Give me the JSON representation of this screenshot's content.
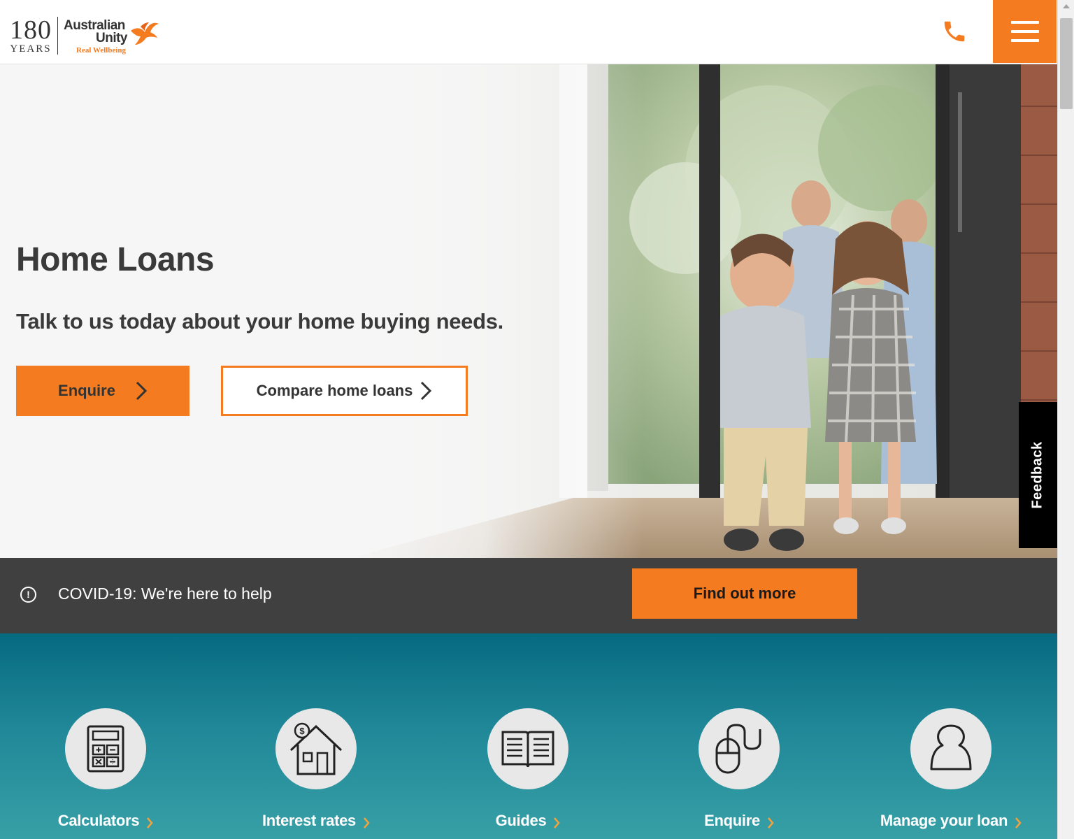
{
  "header": {
    "logo": {
      "anniversary_number": "180",
      "anniversary_word": "YEARS",
      "brand_line1": "Australian",
      "brand_line2": "Unity",
      "tagline": "Real Wellbeing"
    },
    "phone_icon": "phone-icon",
    "menu_icon": "hamburger-menu-icon"
  },
  "hero": {
    "title": "Home Loans",
    "subtitle": "Talk to us today about your home buying needs.",
    "enquire_label": "Enquire",
    "compare_label": "Compare home loans"
  },
  "feedback": {
    "label": "Feedback"
  },
  "covid": {
    "text": "COVID-19: We're here to help",
    "button_label": "Find out more"
  },
  "tiles": [
    {
      "label": "Calculators",
      "icon": "calculator-icon"
    },
    {
      "label": "Interest rates",
      "icon": "house-dollar-icon"
    },
    {
      "label": "Guides",
      "icon": "open-book-icon"
    },
    {
      "label": "Enquire",
      "icon": "computer-mouse-icon"
    },
    {
      "label": "Manage your loan",
      "icon": "user-icon"
    }
  ],
  "colors": {
    "accent": "#f47b20",
    "dark_bar": "#404040",
    "teal_top": "#066a80",
    "teal_bottom": "#37a0a6"
  }
}
